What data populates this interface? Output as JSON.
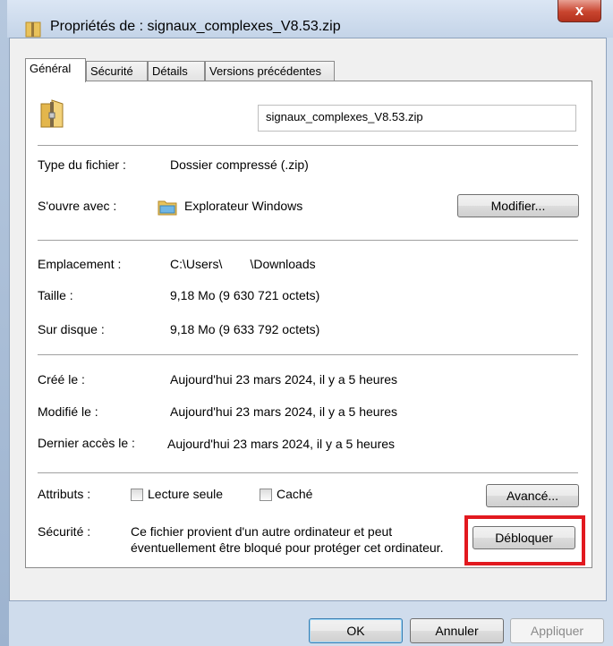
{
  "window": {
    "title": "Propriétés de : signaux_complexes_V8.53.zip",
    "close_label": "x"
  },
  "tabs": [
    "Général",
    "Sécurité",
    "Détails",
    "Versions précédentes"
  ],
  "file": {
    "name": "signaux_complexes_V8.53.zip",
    "icon": "zip-folder-icon"
  },
  "type": {
    "label": "Type du fichier :",
    "value": "Dossier compressé (.zip)"
  },
  "opens_with": {
    "label": "S'ouvre avec :",
    "value": "Explorateur Windows",
    "button": "Modifier..."
  },
  "location": {
    "label": "Emplacement :",
    "value": "C:\\Users\\        \\Downloads"
  },
  "size": {
    "label": "Taille :",
    "value": "9,18 Mo (9 630 721 octets)"
  },
  "disk": {
    "label": "Sur disque :",
    "value": "9,18 Mo (9 633 792 octets)"
  },
  "created": {
    "label": "Créé le :",
    "value": "Aujourd'hui 23 mars 2024, il y a 5 heures"
  },
  "modified": {
    "label": "Modifié le :",
    "value": "Aujourd'hui 23 mars 2024, il y a 5 heures"
  },
  "accessed": {
    "label": "Dernier accès le :",
    "value": "Aujourd'hui 23 mars 2024, il y a 5 heures"
  },
  "attributes": {
    "label": "Attributs :",
    "readonly": "Lecture seule",
    "hidden": "Caché",
    "advanced": "Avancé..."
  },
  "security": {
    "label": "Sécurité :",
    "line1": "Ce fichier provient d'un autre ordinateur et peut",
    "line2": "éventuellement être bloqué pour protéger cet ordinateur.",
    "unblock": "Débloquer"
  },
  "footer": {
    "ok": "OK",
    "cancel": "Annuler",
    "apply": "Appliquer"
  },
  "colors": {
    "highlight": "#e2191f",
    "title_bg": "#c4d4e8"
  }
}
